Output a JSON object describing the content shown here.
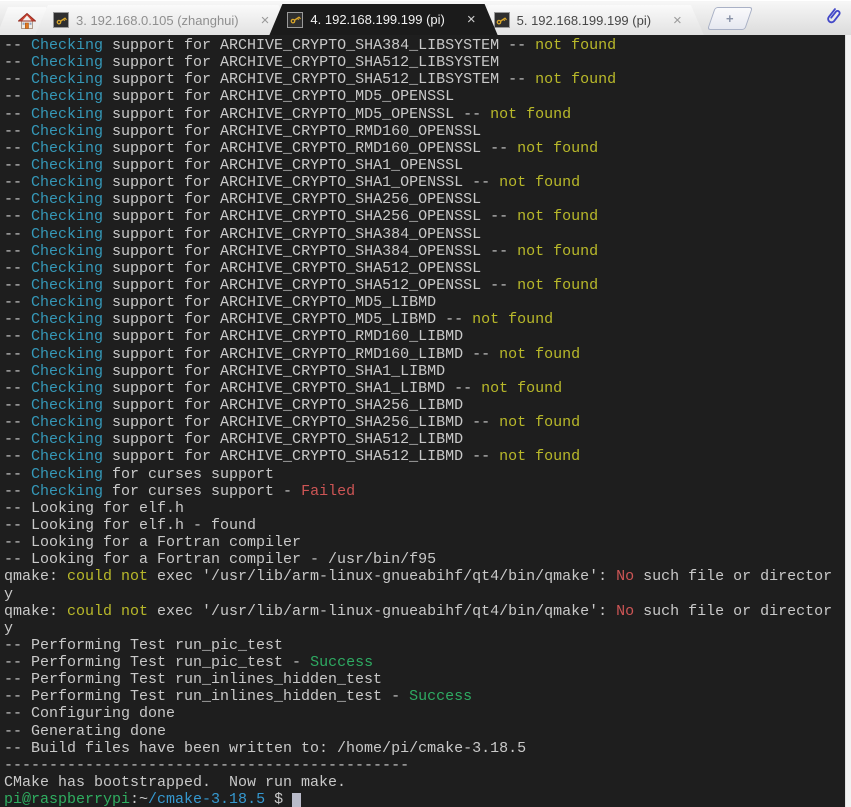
{
  "colors": {
    "bg": "#1e1e1e",
    "fg": "#c9c9c9",
    "cyan": "#3598b8",
    "yellow": "#b9b92a",
    "red": "#cd5555",
    "green": "#2eaa62",
    "blue": "#3598cf",
    "promptgreen": "#2fae60",
    "cursor": "#b9bbc9",
    "keygold": "#d9a62a",
    "clipblue": "#4348c8",
    "activetab": "#1b1b1b"
  },
  "tabbar": {
    "tabs": [
      {
        "label": "3. 192.168.0.105 (zhanghui)",
        "close": "×"
      },
      {
        "label": "4. 192.168.199.199 (pi)",
        "close": "×"
      },
      {
        "label": "5. 192.168.199.199 (pi)",
        "close": "×"
      }
    ],
    "new_tab_label": "+"
  },
  "terminal": {
    "lines": [
      [
        {
          "t": "-- "
        },
        {
          "t": "Checking",
          "c": "cyan"
        },
        {
          "t": " support for ARCHIVE_CRYPTO_SHA384_LIBSYSTEM -- "
        },
        {
          "t": "not found",
          "c": "yellow"
        }
      ],
      [
        {
          "t": "-- "
        },
        {
          "t": "Checking",
          "c": "cyan"
        },
        {
          "t": " support for ARCHIVE_CRYPTO_SHA512_LIBSYSTEM"
        }
      ],
      [
        {
          "t": "-- "
        },
        {
          "t": "Checking",
          "c": "cyan"
        },
        {
          "t": " support for ARCHIVE_CRYPTO_SHA512_LIBSYSTEM -- "
        },
        {
          "t": "not found",
          "c": "yellow"
        }
      ],
      [
        {
          "t": "-- "
        },
        {
          "t": "Checking",
          "c": "cyan"
        },
        {
          "t": " support for ARCHIVE_CRYPTO_MD5_OPENSSL"
        }
      ],
      [
        {
          "t": "-- "
        },
        {
          "t": "Checking",
          "c": "cyan"
        },
        {
          "t": " support for ARCHIVE_CRYPTO_MD5_OPENSSL -- "
        },
        {
          "t": "not found",
          "c": "yellow"
        }
      ],
      [
        {
          "t": "-- "
        },
        {
          "t": "Checking",
          "c": "cyan"
        },
        {
          "t": " support for ARCHIVE_CRYPTO_RMD160_OPENSSL"
        }
      ],
      [
        {
          "t": "-- "
        },
        {
          "t": "Checking",
          "c": "cyan"
        },
        {
          "t": " support for ARCHIVE_CRYPTO_RMD160_OPENSSL -- "
        },
        {
          "t": "not found",
          "c": "yellow"
        }
      ],
      [
        {
          "t": "-- "
        },
        {
          "t": "Checking",
          "c": "cyan"
        },
        {
          "t": " support for ARCHIVE_CRYPTO_SHA1_OPENSSL"
        }
      ],
      [
        {
          "t": "-- "
        },
        {
          "t": "Checking",
          "c": "cyan"
        },
        {
          "t": " support for ARCHIVE_CRYPTO_SHA1_OPENSSL -- "
        },
        {
          "t": "not found",
          "c": "yellow"
        }
      ],
      [
        {
          "t": "-- "
        },
        {
          "t": "Checking",
          "c": "cyan"
        },
        {
          "t": " support for ARCHIVE_CRYPTO_SHA256_OPENSSL"
        }
      ],
      [
        {
          "t": "-- "
        },
        {
          "t": "Checking",
          "c": "cyan"
        },
        {
          "t": " support for ARCHIVE_CRYPTO_SHA256_OPENSSL -- "
        },
        {
          "t": "not found",
          "c": "yellow"
        }
      ],
      [
        {
          "t": "-- "
        },
        {
          "t": "Checking",
          "c": "cyan"
        },
        {
          "t": " support for ARCHIVE_CRYPTO_SHA384_OPENSSL"
        }
      ],
      [
        {
          "t": "-- "
        },
        {
          "t": "Checking",
          "c": "cyan"
        },
        {
          "t": " support for ARCHIVE_CRYPTO_SHA384_OPENSSL -- "
        },
        {
          "t": "not found",
          "c": "yellow"
        }
      ],
      [
        {
          "t": "-- "
        },
        {
          "t": "Checking",
          "c": "cyan"
        },
        {
          "t": " support for ARCHIVE_CRYPTO_SHA512_OPENSSL"
        }
      ],
      [
        {
          "t": "-- "
        },
        {
          "t": "Checking",
          "c": "cyan"
        },
        {
          "t": " support for ARCHIVE_CRYPTO_SHA512_OPENSSL -- "
        },
        {
          "t": "not found",
          "c": "yellow"
        }
      ],
      [
        {
          "t": "-- "
        },
        {
          "t": "Checking",
          "c": "cyan"
        },
        {
          "t": " support for ARCHIVE_CRYPTO_MD5_LIBMD"
        }
      ],
      [
        {
          "t": "-- "
        },
        {
          "t": "Checking",
          "c": "cyan"
        },
        {
          "t": " support for ARCHIVE_CRYPTO_MD5_LIBMD -- "
        },
        {
          "t": "not found",
          "c": "yellow"
        }
      ],
      [
        {
          "t": "-- "
        },
        {
          "t": "Checking",
          "c": "cyan"
        },
        {
          "t": " support for ARCHIVE_CRYPTO_RMD160_LIBMD"
        }
      ],
      [
        {
          "t": "-- "
        },
        {
          "t": "Checking",
          "c": "cyan"
        },
        {
          "t": " support for ARCHIVE_CRYPTO_RMD160_LIBMD -- "
        },
        {
          "t": "not found",
          "c": "yellow"
        }
      ],
      [
        {
          "t": "-- "
        },
        {
          "t": "Checking",
          "c": "cyan"
        },
        {
          "t": " support for ARCHIVE_CRYPTO_SHA1_LIBMD"
        }
      ],
      [
        {
          "t": "-- "
        },
        {
          "t": "Checking",
          "c": "cyan"
        },
        {
          "t": " support for ARCHIVE_CRYPTO_SHA1_LIBMD -- "
        },
        {
          "t": "not found",
          "c": "yellow"
        }
      ],
      [
        {
          "t": "-- "
        },
        {
          "t": "Checking",
          "c": "cyan"
        },
        {
          "t": " support for ARCHIVE_CRYPTO_SHA256_LIBMD"
        }
      ],
      [
        {
          "t": "-- "
        },
        {
          "t": "Checking",
          "c": "cyan"
        },
        {
          "t": " support for ARCHIVE_CRYPTO_SHA256_LIBMD -- "
        },
        {
          "t": "not found",
          "c": "yellow"
        }
      ],
      [
        {
          "t": "-- "
        },
        {
          "t": "Checking",
          "c": "cyan"
        },
        {
          "t": " support for ARCHIVE_CRYPTO_SHA512_LIBMD"
        }
      ],
      [
        {
          "t": "-- "
        },
        {
          "t": "Checking",
          "c": "cyan"
        },
        {
          "t": " support for ARCHIVE_CRYPTO_SHA512_LIBMD -- "
        },
        {
          "t": "not found",
          "c": "yellow"
        }
      ],
      [
        {
          "t": "-- "
        },
        {
          "t": "Checking",
          "c": "cyan"
        },
        {
          "t": " for curses support"
        }
      ],
      [
        {
          "t": "-- "
        },
        {
          "t": "Checking",
          "c": "cyan"
        },
        {
          "t": " for curses support - "
        },
        {
          "t": "Failed",
          "c": "red"
        }
      ],
      [
        {
          "t": "-- Looking for elf.h"
        }
      ],
      [
        {
          "t": "-- Looking for elf.h - found"
        }
      ],
      [
        {
          "t": "-- Looking for a Fortran compiler"
        }
      ],
      [
        {
          "t": "-- Looking for a Fortran compiler - /usr/bin/f95"
        }
      ],
      [
        {
          "t": "qmake: "
        },
        {
          "t": "could not",
          "c": "yellow"
        },
        {
          "t": " exec '/usr/lib/arm-linux-gnueabihf/qt4/bin/qmake': "
        },
        {
          "t": "No",
          "c": "red"
        },
        {
          "t": " such file or director"
        }
      ],
      [
        {
          "t": "y"
        }
      ],
      [
        {
          "t": "qmake: "
        },
        {
          "t": "could not",
          "c": "yellow"
        },
        {
          "t": " exec '/usr/lib/arm-linux-gnueabihf/qt4/bin/qmake': "
        },
        {
          "t": "No",
          "c": "red"
        },
        {
          "t": " such file or director"
        }
      ],
      [
        {
          "t": "y"
        }
      ],
      [
        {
          "t": "-- Performing Test run_pic_test"
        }
      ],
      [
        {
          "t": "-- Performing Test run_pic_test - "
        },
        {
          "t": "Success",
          "c": "green"
        }
      ],
      [
        {
          "t": "-- Performing Test run_inlines_hidden_test"
        }
      ],
      [
        {
          "t": "-- Performing Test run_inlines_hidden_test - "
        },
        {
          "t": "Success",
          "c": "green"
        }
      ],
      [
        {
          "t": "-- Configuring done"
        }
      ],
      [
        {
          "t": "-- Generating done"
        }
      ],
      [
        {
          "t": "-- Build files have been written to: /home/pi/cmake-3.18.5"
        }
      ],
      [
        {
          "t": "---------------------------------------------"
        }
      ],
      [
        {
          "t": "CMake has bootstrapped.  Now run make."
        }
      ],
      [
        {
          "t": "pi@raspberrypi",
          "c": "promptgreen"
        },
        {
          "t": ":~"
        },
        {
          "t": "/cmake-3.18.5",
          "c": "blue"
        },
        {
          "t": " $ "
        },
        {
          "t": " ",
          "c": "cursor"
        }
      ]
    ]
  }
}
